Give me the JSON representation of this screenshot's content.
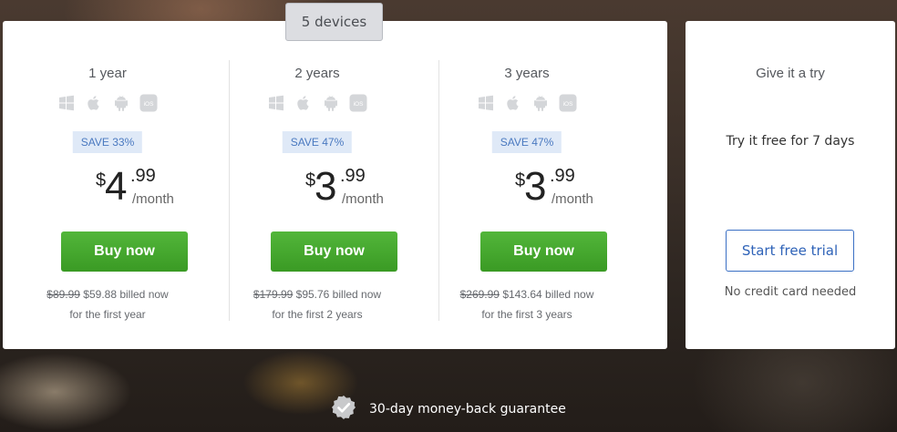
{
  "tab": {
    "label": "5 devices"
  },
  "plans": [
    {
      "title": "1 year",
      "save": "SAVE 33%",
      "currency": "$",
      "price_int": "4",
      "price_dec": ".99",
      "period": "/month",
      "button": "Buy now",
      "old_price": "$89.99",
      "billed": " $59.88 billed now",
      "billed_note": "for the first year"
    },
    {
      "title": "2 years",
      "save": "SAVE 47%",
      "currency": "$",
      "price_int": "3",
      "price_dec": ".99",
      "period": "/month",
      "button": "Buy now",
      "old_price": "$179.99",
      "billed": " $95.76 billed now",
      "billed_note": "for the first 2 years"
    },
    {
      "title": "3 years",
      "save": "SAVE 47%",
      "currency": "$",
      "price_int": "3",
      "price_dec": ".99",
      "period": "/month",
      "button": "Buy now",
      "old_price": "$269.99",
      "billed": " $143.64 billed now",
      "billed_note": "for the first 3 years"
    }
  ],
  "platform_icons": [
    "windows-icon",
    "apple-icon",
    "android-icon",
    "ios-icon"
  ],
  "platform_ios_label": "iOS",
  "trial": {
    "title": "Give it a try",
    "subtitle": "Try it free for 7 days",
    "button": "Start free trial",
    "note": "No credit card needed"
  },
  "guarantee": {
    "text": "30-day money-back guarantee",
    "icon": "verified-badge-icon"
  },
  "colors": {
    "buy_green": "#44a82e",
    "trial_blue": "#2f63b8",
    "save_bg": "#dfe9f7",
    "save_text": "#4a79c0"
  }
}
